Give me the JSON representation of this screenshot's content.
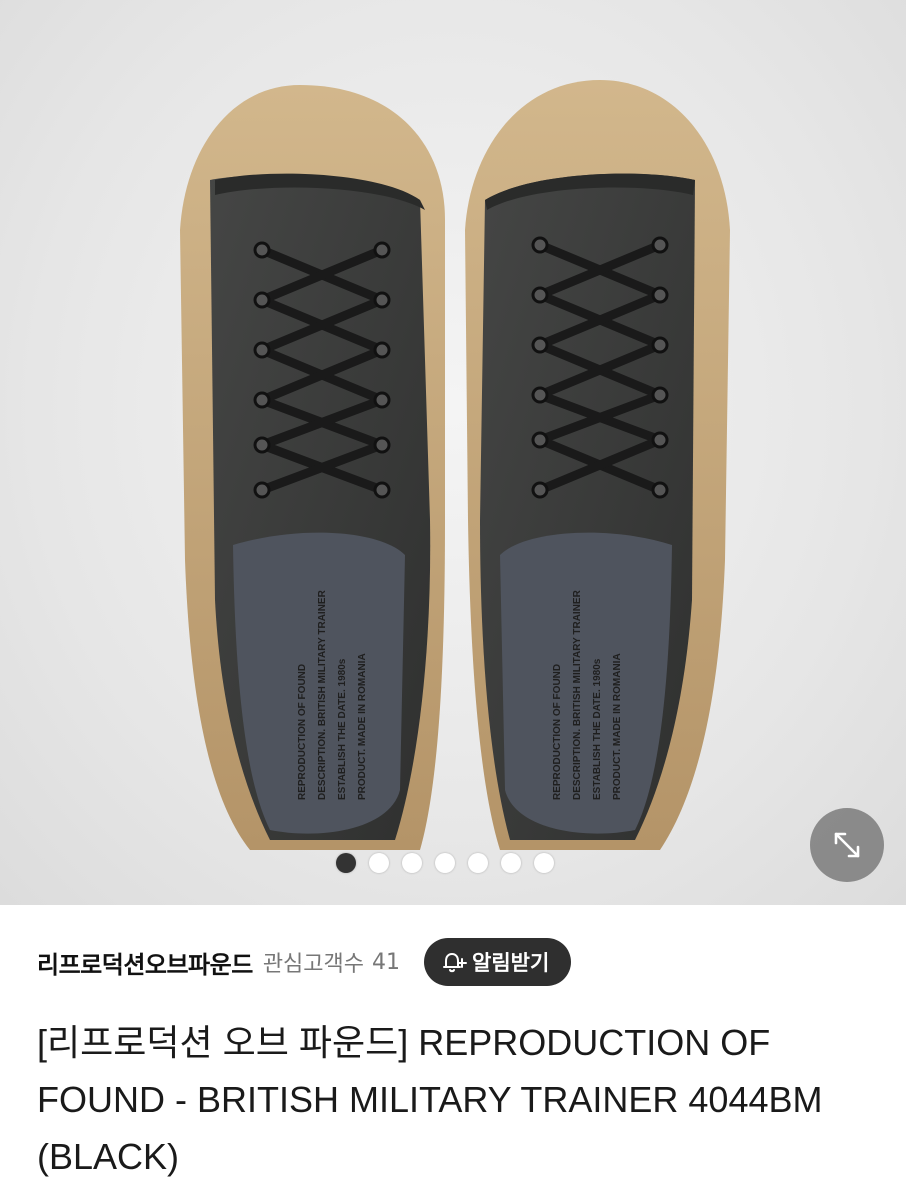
{
  "gallery": {
    "image_label": "black canvas sneakers top view",
    "insole_text": [
      "REPRODUCTION OF FOUND",
      "DESCRIPTION. BRITISH MILITARY TRAINER",
      "ESTABLISH THE DATE. 1980s",
      "PRODUCT. MADE IN ROMANIA"
    ],
    "dots_total": 7,
    "active_dot": 1,
    "expand_icon": "expand-arrows-icon"
  },
  "shop": {
    "name": "리프로덕션오브파운드",
    "follower_label": "관심고객수",
    "follower_count": "41",
    "notify_icon": "bell-plus-icon",
    "notify_label": "알림받기"
  },
  "product": {
    "title": "[리프로덕션 오브 파운드] REPRODUCTION OF FOUND - BRITISH MILITARY TRAINER 4044BM (BLACK)"
  },
  "colors": {
    "upper": "#3b3c3b",
    "sole": "#c8ab7f",
    "button_dark": "#2f2f2f"
  }
}
